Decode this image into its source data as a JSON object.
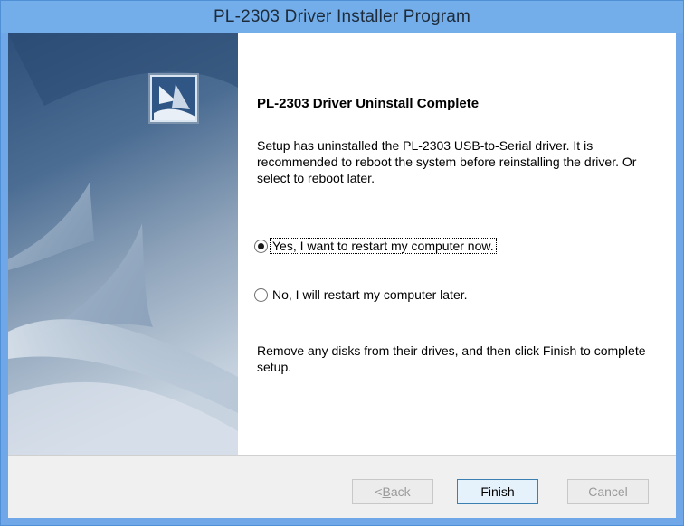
{
  "window": {
    "title": "PL-2303 Driver Installer Program"
  },
  "page": {
    "heading": "PL-2303 Driver Uninstall Complete",
    "body": "Setup has uninstalled the PL-2303 USB-to-Serial driver. It is recommended to reboot the system before reinstalling the driver. Or select to reboot later.",
    "footer": "Remove any disks from their drives, and then click Finish to complete setup."
  },
  "options": [
    {
      "label": "Yes, I want to restart my computer now.",
      "selected": true
    },
    {
      "label": "No, I will restart my computer later.",
      "selected": false
    }
  ],
  "buttons": {
    "back_prefix": "< ",
    "back_mnemonic": "B",
    "back_rest": "ack",
    "finish": "Finish",
    "cancel": "Cancel"
  },
  "colors": {
    "titlebar": "#73aeea",
    "side_art_top": "#33557f",
    "side_art_bottom": "#c7d3df",
    "default_button_border": "#3c7fb1"
  },
  "icons": {
    "logo": "installer-sails-logo"
  }
}
